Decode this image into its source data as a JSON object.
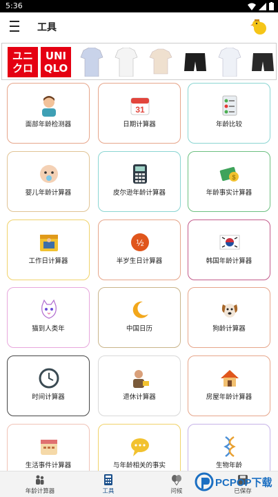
{
  "status_bar": {
    "time": "5:36"
  },
  "appbar": {
    "title": "工具"
  },
  "banner": {
    "brand_line1": "UNI",
    "brand_line2": "QLO",
    "brand_left_line1": "ユニ",
    "brand_left_line2": "クロ"
  },
  "cards": [
    {
      "label": "面部年龄检测器",
      "icon": "face-age-icon",
      "border": "#e6a58a"
    },
    {
      "label": "日期计算器",
      "icon": "calendar-icon",
      "border": "#e6a58a"
    },
    {
      "label": "年龄比较",
      "icon": "compare-icon",
      "border": "#8ad5d2"
    },
    {
      "label": "婴儿年龄计算器",
      "icon": "baby-icon",
      "border": "#e0c394"
    },
    {
      "label": "皮尔逊年龄计算器",
      "icon": "abacus-icon",
      "border": "#8ad5d2"
    },
    {
      "label": "年龄事实计算器",
      "icon": "money-icon",
      "border": "#6cbf80"
    },
    {
      "label": "工作日计算器",
      "icon": "work-calendar-icon",
      "border": "#f0d26a"
    },
    {
      "label": "半岁生日计算器",
      "icon": "half-icon",
      "border": "#e6a58a"
    },
    {
      "label": "韩国年龄计算器",
      "icon": "korea-flag-icon",
      "border": "#c25a8a"
    },
    {
      "label": "猫到人类年",
      "icon": "cat-icon",
      "border": "#e7a6dc"
    },
    {
      "label": "中国日历",
      "icon": "moon-icon",
      "border": "#c9b48a"
    },
    {
      "label": "狗龄计算器",
      "icon": "dog-icon",
      "border": "#e6a58a"
    },
    {
      "label": "时间计算器",
      "icon": "clock-icon",
      "border": "#444444"
    },
    {
      "label": "退休计算器",
      "icon": "retire-icon",
      "border": "#d8d8d8"
    },
    {
      "label": "房屋年龄计算器",
      "icon": "house-icon",
      "border": "#e6a58a"
    },
    {
      "label": "生活事件计算器",
      "icon": "event-icon",
      "border": "#f0c2b6"
    },
    {
      "label": "与年龄相关的事实",
      "icon": "chat-icon",
      "border": "#f0d26a"
    },
    {
      "label": "生物年龄",
      "icon": "dna-icon",
      "border": "#c6b3e8"
    }
  ],
  "bottom_nav": [
    {
      "label": "年龄计算器",
      "icon": "people-icon"
    },
    {
      "label": "工具",
      "icon": "tools-icon"
    },
    {
      "label": "问候",
      "icon": "balloon-icon"
    },
    {
      "label": "已保存",
      "icon": "save-icon"
    }
  ],
  "watermark": {
    "text": "PCPOP下载"
  }
}
